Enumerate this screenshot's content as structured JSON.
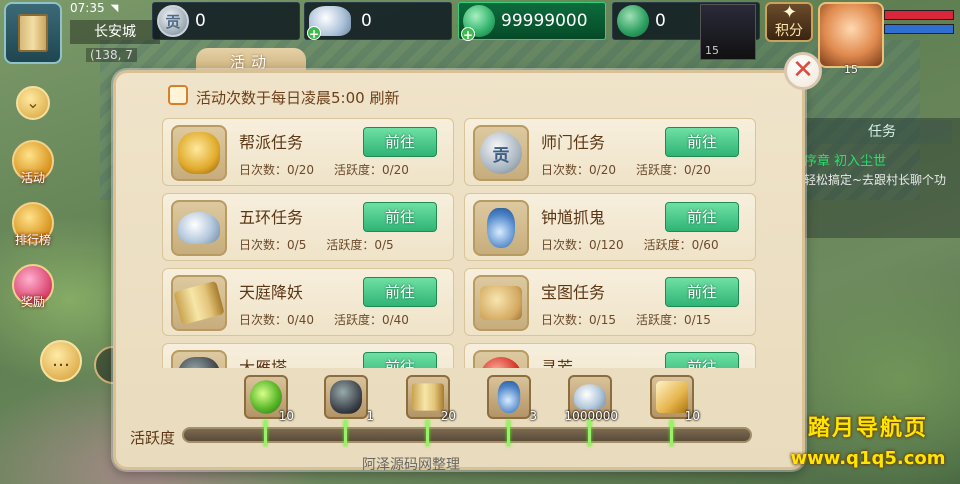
{
  "hud": {
    "time": "07:35",
    "wifi": "◥",
    "city": "长安城",
    "coords": "(138, 7",
    "currencies": {
      "coin_value": "0",
      "coin_glyph": "贡",
      "silver_value": "0",
      "jade_value": "99999000",
      "locked_jade_value": "0"
    },
    "small_portrait_level": "15",
    "points_label": "积分",
    "avatar_level": "15"
  },
  "side_menu": {
    "activity_label": "活动",
    "ranking_label": "排行榜",
    "reward_label": "奖励"
  },
  "task_panel": {
    "tab_label": "任务",
    "quest_title": "序章 初入尘世",
    "quest_desc": "轻松搞定~去跟村长聊个功"
  },
  "dialog": {
    "tab_label": "活动",
    "hint": "活动次数于每日凌晨5:00 刷新",
    "close_label": "✕",
    "count_prefix": "日次数：",
    "vitality_prefix": "活跃度：",
    "go_label": "前往",
    "activities": [
      {
        "name": "帮派任务",
        "count": "0/20",
        "vitality": "0/20",
        "icon": "gold-ingot-icon"
      },
      {
        "name": "师门任务",
        "count": "0/20",
        "vitality": "0/20",
        "icon": "contribution-coin-icon"
      },
      {
        "name": "五环任务",
        "count": "0/5",
        "vitality": "0/5",
        "icon": "silver-ingot-icon"
      },
      {
        "name": "钟馗抓鬼",
        "count": "0/120",
        "vitality": "0/60",
        "icon": "plant-vase-icon"
      },
      {
        "name": "天庭降妖",
        "count": "0/40",
        "vitality": "0/40",
        "icon": "scroll-icon"
      },
      {
        "name": "宝图任务",
        "count": "0/15",
        "vitality": "0/15",
        "icon": "treasure-map-icon"
      },
      {
        "name": "大雁塔",
        "count": "",
        "vitality": "",
        "icon": "dark-armor-icon"
      },
      {
        "name": "寻芳",
        "count": "",
        "vitality": "",
        "icon": "red-gem-icon"
      }
    ],
    "vitality_label": "活跃度",
    "rewards": [
      {
        "count": "10",
        "icon": "green-orb-icon"
      },
      {
        "count": "1",
        "icon": "dark-armor-icon"
      },
      {
        "count": "20",
        "icon": "scroll-icon"
      },
      {
        "count": "3",
        "icon": "plant-vase-icon"
      },
      {
        "count": "1000000",
        "icon": "silver-ingot-icon"
      },
      {
        "count": "10",
        "icon": "trophy-icon"
      }
    ],
    "vitality_progress": 0
  },
  "footer_text": "阿泽源码网整理",
  "watermark": {
    "line1": "踏月导航页",
    "line2": "www.q1q5.com"
  },
  "colors": {
    "go_button": "#2fb476",
    "tick": "#9af06a",
    "close_x": "#e0483c"
  }
}
